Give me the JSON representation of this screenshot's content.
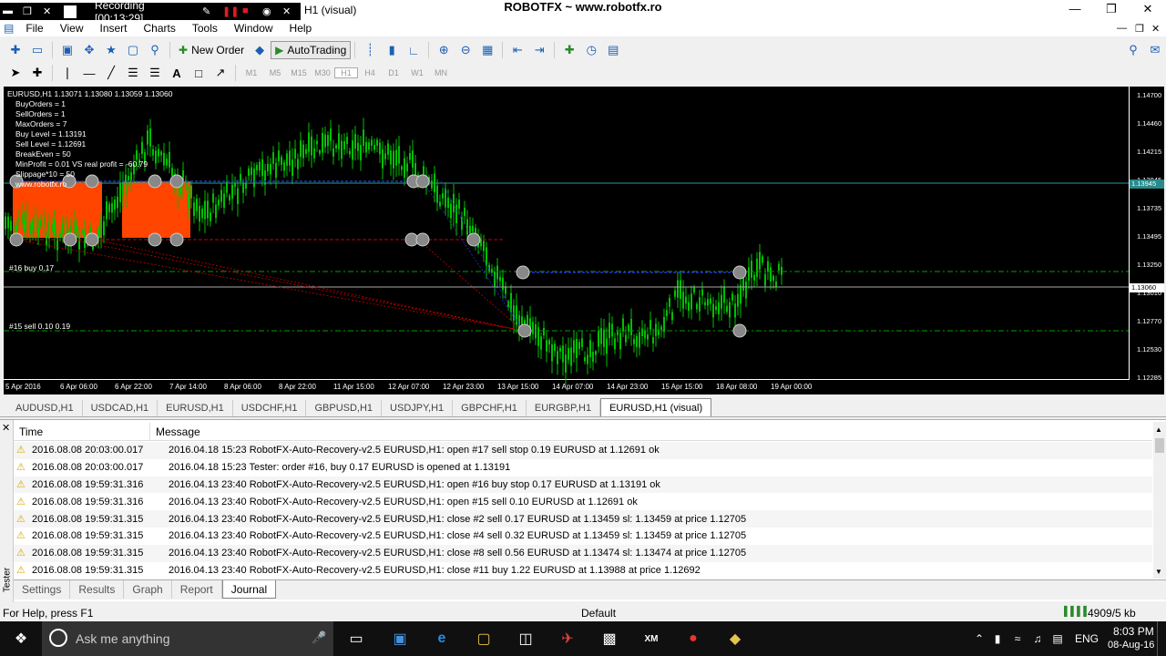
{
  "recorder": {
    "label": "Recording [00:13:29]"
  },
  "window": {
    "app_title": "ROBOTFX ~ www.robotfx.ro",
    "child_title": "H1 (visual)"
  },
  "menu": [
    "File",
    "View",
    "Insert",
    "Charts",
    "Tools",
    "Window",
    "Help"
  ],
  "toolbar": {
    "new_order": "New Order",
    "auto_trading": "AutoTrading"
  },
  "timeframes": [
    "M1",
    "M5",
    "M15",
    "M30",
    "H1",
    "H4",
    "D1",
    "W1",
    "MN"
  ],
  "chart": {
    "header": "EURUSD,H1  1.13071 1.13080 1.13059 1.13060",
    "info_lines": [
      "BuyOrders = 1",
      "SellOrders = 1",
      "MaxOrders = 7",
      "Buy Level = 1.13191",
      "Sell Level = 1.12691",
      "BreakEven = 50",
      "MinProfit = 0.01 VS real profit = -60.79",
      "Slippage*10 = 50",
      "www.robotfx.ro"
    ],
    "label_buy": "#16 buy 0.17",
    "label_sell": "#15 sell 0.10 0.19",
    "current_price": "1.13060",
    "level_price": "1.13945",
    "price_ticks": [
      "1.14700",
      "1.14460",
      "1.14215",
      "1.13945",
      "1.13735",
      "1.13495",
      "1.13250",
      "1.13010",
      "1.12770",
      "1.12530",
      "1.12285"
    ],
    "time_ticks": [
      "5 Apr 2016",
      "6 Apr 06:00",
      "6 Apr 22:00",
      "7 Apr 14:00",
      "8 Apr 06:00",
      "8 Apr 22:00",
      "11 Apr 15:00",
      "12 Apr 07:00",
      "12 Apr 23:00",
      "13 Apr 15:00",
      "14 Apr 07:00",
      "14 Apr 23:00",
      "15 Apr 15:00",
      "18 Apr 08:00",
      "19 Apr 00:00"
    ]
  },
  "symbol_tabs": [
    "AUDUSD,H1",
    "USDCAD,H1",
    "EURUSD,H1",
    "USDCHF,H1",
    "GBPUSD,H1",
    "USDJPY,H1",
    "GBPCHF,H1",
    "EURGBP,H1",
    "EURUSD,H1 (visual)"
  ],
  "journal": {
    "col_time": "Time",
    "col_message": "Message",
    "rows": [
      {
        "time": "2016.08.08 20:03:00.017",
        "msg": "2016.04.18 15:23  RobotFX-Auto-Recovery-v2.5 EURUSD,H1: open #17 sell stop 0.19 EURUSD at 1.12691 ok"
      },
      {
        "time": "2016.08.08 20:03:00.017",
        "msg": "2016.04.18 15:23  Tester: order #16, buy 0.17 EURUSD is opened at 1.13191"
      },
      {
        "time": "2016.08.08 19:59:31.316",
        "msg": "2016.04.13 23:40  RobotFX-Auto-Recovery-v2.5 EURUSD,H1: open #16 buy stop 0.17 EURUSD at 1.13191 ok"
      },
      {
        "time": "2016.08.08 19:59:31.316",
        "msg": "2016.04.13 23:40  RobotFX-Auto-Recovery-v2.5 EURUSD,H1: open #15 sell 0.10 EURUSD at 1.12691 ok"
      },
      {
        "time": "2016.08.08 19:59:31.315",
        "msg": "2016.04.13 23:40  RobotFX-Auto-Recovery-v2.5 EURUSD,H1: close #2 sell 0.17 EURUSD at 1.13459 sl: 1.13459 at price 1.12705"
      },
      {
        "time": "2016.08.08 19:59:31.315",
        "msg": "2016.04.13 23:40  RobotFX-Auto-Recovery-v2.5 EURUSD,H1: close #4 sell 0.32 EURUSD at 1.13459 sl: 1.13459 at price 1.12705"
      },
      {
        "time": "2016.08.08 19:59:31.315",
        "msg": "2016.04.13 23:40  RobotFX-Auto-Recovery-v2.5 EURUSD,H1: close #8 sell 0.56 EURUSD at 1.13474 sl: 1.13474 at price 1.12705"
      },
      {
        "time": "2016.08.08 19:59:31.315",
        "msg": "2016.04.13 23:40  RobotFX-Auto-Recovery-v2.5 EURUSD,H1: close #11 buy 1.22 EURUSD at 1.13988 at price 1.12692"
      }
    ]
  },
  "tester_tabs": [
    "Settings",
    "Results",
    "Graph",
    "Report",
    "Journal"
  ],
  "tester_side_label": "Tester",
  "status": {
    "help": "For Help, press F1",
    "profile": "Default",
    "traffic": "4909/5 kb"
  },
  "taskbar": {
    "search_placeholder": "Ask me anything",
    "lang": "ENG",
    "time": "8:03 PM",
    "date": "08-Aug-16"
  },
  "colors": {
    "chart_bg": "#000000",
    "bull_candle": "#00c000",
    "fill_zone": "#ff4500",
    "buy_line": "#00a000",
    "sell_line": "#c00000"
  }
}
